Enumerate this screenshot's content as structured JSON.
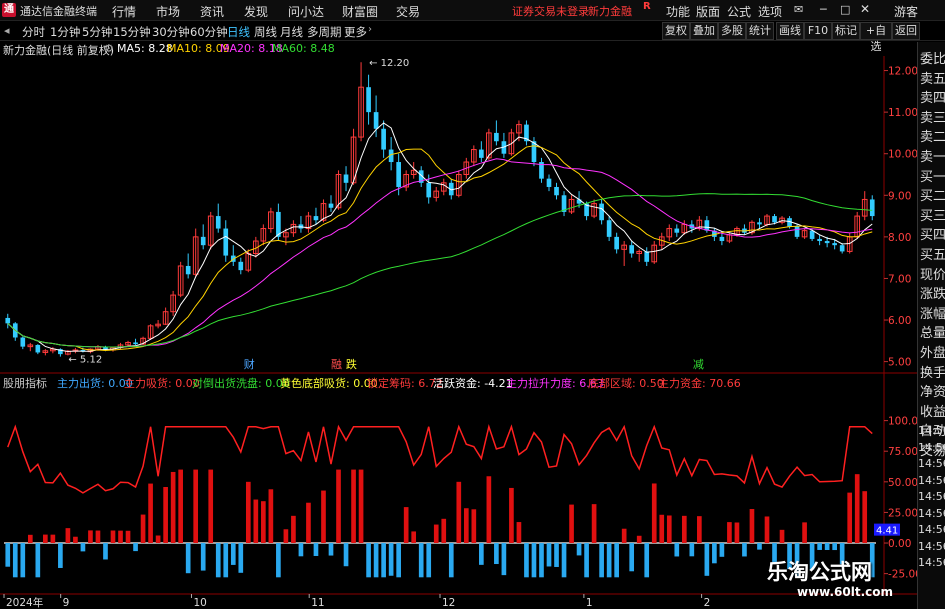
{
  "menubar": {
    "app_title": "通达信金融终端",
    "items": [
      "行情",
      "市场",
      "资讯",
      "发现",
      "问小达",
      "财富圈",
      "交易"
    ],
    "notice": "证券交易未登录",
    "broker": "新力金融",
    "right_items": [
      "功能",
      "版面",
      "公式",
      "选项"
    ],
    "user": "游客"
  },
  "periods": [
    "分时",
    "1分钟",
    "5分钟",
    "15分钟",
    "30分钟",
    "60分钟",
    "日线",
    "周线",
    "月线",
    "多周期",
    "更多"
  ],
  "active_period": "日线",
  "right_buttons": [
    "复权",
    "叠加",
    "多股",
    "统计",
    "画线",
    "F10",
    "标记",
    "+自选",
    "返回"
  ],
  "stock": {
    "label": "新力金融(日线 前复权)"
  },
  "ma": {
    "ma5": {
      "label": "MA5: 8.28",
      "color": "#ffffff"
    },
    "ma10": {
      "label": "MA10: 8.09",
      "color": "#ffd200"
    },
    "ma20": {
      "label": "MA20: 8.18",
      "color": "#ff33ff"
    },
    "ma60": {
      "label": "MA60: 8.48",
      "color": "#33dd33"
    }
  },
  "indicator_line": [
    {
      "text": "股朋指标",
      "color": "#cccccc"
    },
    {
      "text": "主力出货: 0.00",
      "color": "#3fa9ff"
    },
    {
      "text": "主力吸货: 0.00",
      "color": "#ff3b3b"
    },
    {
      "text": "对倒出货洗盘: 0.00",
      "color": "#33dd33"
    },
    {
      "text": "黄色底部吸货: 0.00",
      "color": "#ffff33"
    },
    {
      "text": "锁定筹码: 6.72",
      "color": "#ff3b3b"
    },
    {
      "text": "活跃资金: -4.21",
      "color": "#ffffff"
    },
    {
      "text": "主力拉升力度: 6.63",
      "color": "#ff33ff"
    },
    {
      "text": "底部区域: 0.50",
      "color": "#ff3b3b"
    },
    {
      "text": "主力资金: 70.66",
      "color": "#ff3b3b"
    }
  ],
  "sidebar": [
    "委比",
    "卖五",
    "卖四",
    "卖三",
    "卖二",
    "卖一",
    "买一",
    "买二",
    "买三",
    "买四",
    "买五",
    "现价",
    "涨跌",
    "涨幅",
    "总量",
    "外盘",
    "换手",
    "净资",
    "收益",
    "自动",
    "交易"
  ],
  "time_labels": [
    "14:56",
    "14:56",
    "14:56",
    "14:56",
    "14:56",
    "14:56",
    "14:56",
    "14:56",
    "14:56"
  ],
  "watermark": {
    "title": "乐淘公式网",
    "url": "www.60lt.com"
  },
  "chart_data": {
    "type": "candlestick",
    "x_labels": [
      "2024年",
      "9",
      "10",
      "11",
      "12",
      "1",
      "2"
    ],
    "y_ticks": [
      5.0,
      6.0,
      7.0,
      8.0,
      9.0,
      10.0,
      11.0,
      12.0
    ],
    "y_tick_labels": [
      "5.00",
      "6.00",
      "7.00",
      "8.00",
      "9.00",
      "10.00",
      "11.00",
      "12.00"
    ],
    "ylim": [
      4.75,
      12.35
    ],
    "annotations": {
      "high": "12.20",
      "low": "5.12",
      "events": [
        {
          "text": "财",
          "color": "#4da6ff"
        },
        {
          "text": "融",
          "color": "#ff4d4d"
        },
        {
          "text": "跌",
          "color": "#ffff33"
        },
        {
          "text": "减",
          "color": "#33dd33"
        }
      ]
    },
    "ohlc": [
      [
        6.05,
        6.15,
        5.8,
        5.92
      ],
      [
        5.92,
        5.95,
        5.5,
        5.58
      ],
      [
        5.58,
        5.6,
        5.3,
        5.36
      ],
      [
        5.36,
        5.45,
        5.25,
        5.4
      ],
      [
        5.4,
        5.42,
        5.18,
        5.22
      ],
      [
        5.22,
        5.3,
        5.15,
        5.26
      ],
      [
        5.26,
        5.35,
        5.2,
        5.3
      ],
      [
        5.3,
        5.32,
        5.12,
        5.18
      ],
      [
        5.18,
        5.28,
        5.15,
        5.25
      ],
      [
        5.25,
        5.33,
        5.2,
        5.28
      ],
      [
        5.28,
        5.34,
        5.22,
        5.24
      ],
      [
        5.24,
        5.32,
        5.2,
        5.3
      ],
      [
        5.3,
        5.4,
        5.26,
        5.36
      ],
      [
        5.36,
        5.38,
        5.25,
        5.28
      ],
      [
        5.28,
        5.36,
        5.24,
        5.34
      ],
      [
        5.34,
        5.45,
        5.3,
        5.4
      ],
      [
        5.4,
        5.5,
        5.35,
        5.46
      ],
      [
        5.46,
        5.55,
        5.4,
        5.42
      ],
      [
        5.42,
        5.6,
        5.4,
        5.56
      ],
      [
        5.56,
        5.9,
        5.52,
        5.86
      ],
      [
        5.86,
        6.0,
        5.8,
        5.9
      ],
      [
        5.9,
        6.3,
        5.88,
        6.2
      ],
      [
        6.2,
        6.7,
        6.1,
        6.6
      ],
      [
        6.6,
        7.4,
        6.55,
        7.3
      ],
      [
        7.3,
        7.6,
        7.0,
        7.1
      ],
      [
        7.1,
        8.2,
        7.05,
        8.0
      ],
      [
        8.0,
        8.3,
        7.7,
        7.8
      ],
      [
        7.8,
        8.6,
        7.7,
        8.5
      ],
      [
        8.5,
        8.8,
        8.1,
        8.2
      ],
      [
        8.2,
        8.4,
        7.4,
        7.55
      ],
      [
        7.55,
        7.8,
        7.3,
        7.4
      ],
      [
        7.4,
        7.5,
        7.1,
        7.2
      ],
      [
        7.2,
        7.7,
        7.15,
        7.6
      ],
      [
        7.6,
        8.0,
        7.5,
        7.9
      ],
      [
        7.9,
        8.3,
        7.8,
        8.2
      ],
      [
        8.2,
        8.7,
        8.1,
        8.6
      ],
      [
        8.6,
        8.8,
        7.9,
        8.0
      ],
      [
        8.0,
        8.2,
        7.8,
        8.1
      ],
      [
        8.1,
        8.4,
        8.0,
        8.3
      ],
      [
        8.3,
        8.5,
        8.1,
        8.2
      ],
      [
        8.2,
        8.6,
        8.1,
        8.5
      ],
      [
        8.5,
        8.7,
        8.3,
        8.4
      ],
      [
        8.4,
        8.9,
        8.35,
        8.8
      ],
      [
        8.8,
        9.0,
        8.6,
        8.7
      ],
      [
        8.7,
        9.6,
        8.65,
        9.5
      ],
      [
        9.5,
        9.7,
        9.1,
        9.3
      ],
      [
        9.3,
        10.6,
        9.25,
        10.4
      ],
      [
        10.4,
        12.2,
        10.3,
        11.6
      ],
      [
        11.6,
        11.9,
        10.7,
        11.0
      ],
      [
        11.0,
        11.4,
        10.4,
        10.6
      ],
      [
        10.6,
        10.8,
        9.9,
        10.1
      ],
      [
        10.1,
        10.4,
        9.6,
        9.8
      ],
      [
        9.8,
        10.0,
        9.0,
        9.2
      ],
      [
        9.2,
        9.6,
        9.1,
        9.5
      ],
      [
        9.5,
        9.8,
        9.4,
        9.6
      ],
      [
        9.6,
        9.7,
        9.2,
        9.3
      ],
      [
        9.3,
        9.5,
        8.8,
        8.95
      ],
      [
        8.95,
        9.2,
        8.85,
        9.1
      ],
      [
        9.1,
        9.4,
        9.0,
        9.3
      ],
      [
        9.3,
        9.4,
        8.9,
        9.0
      ],
      [
        9.0,
        9.6,
        8.95,
        9.5
      ],
      [
        9.5,
        9.9,
        9.4,
        9.8
      ],
      [
        9.8,
        10.2,
        9.7,
        10.1
      ],
      [
        10.1,
        10.3,
        9.8,
        9.9
      ],
      [
        9.9,
        10.6,
        9.85,
        10.5
      ],
      [
        10.5,
        10.8,
        10.2,
        10.3
      ],
      [
        10.3,
        10.5,
        9.9,
        10.0
      ],
      [
        10.0,
        10.6,
        9.95,
        10.5
      ],
      [
        10.5,
        10.8,
        10.3,
        10.7
      ],
      [
        10.7,
        10.8,
        10.2,
        10.3
      ],
      [
        10.3,
        10.4,
        9.7,
        9.8
      ],
      [
        9.8,
        9.9,
        9.3,
        9.4
      ],
      [
        9.4,
        9.5,
        9.1,
        9.2
      ],
      [
        9.2,
        9.3,
        8.9,
        9.0
      ],
      [
        9.0,
        9.1,
        8.5,
        8.6
      ],
      [
        8.6,
        9.0,
        8.55,
        8.9
      ],
      [
        8.9,
        9.1,
        8.7,
        8.8
      ],
      [
        8.8,
        8.85,
        8.4,
        8.5
      ],
      [
        8.5,
        8.9,
        8.45,
        8.8
      ],
      [
        8.8,
        8.9,
        8.3,
        8.4
      ],
      [
        8.4,
        8.5,
        7.9,
        8.0
      ],
      [
        8.0,
        8.1,
        7.6,
        7.7
      ],
      [
        7.7,
        7.9,
        7.3,
        7.8
      ],
      [
        7.8,
        7.9,
        7.5,
        7.6
      ],
      [
        7.6,
        7.7,
        7.4,
        7.65
      ],
      [
        7.65,
        7.75,
        7.3,
        7.4
      ],
      [
        7.4,
        7.9,
        7.35,
        7.8
      ],
      [
        7.8,
        8.1,
        7.7,
        8.0
      ],
      [
        8.0,
        8.3,
        7.9,
        8.2
      ],
      [
        8.2,
        8.3,
        8.0,
        8.1
      ],
      [
        8.1,
        8.4,
        8.05,
        8.3
      ],
      [
        8.3,
        8.4,
        8.1,
        8.2
      ],
      [
        8.2,
        8.5,
        8.15,
        8.4
      ],
      [
        8.4,
        8.5,
        8.1,
        8.15
      ],
      [
        8.15,
        8.2,
        7.9,
        8.0
      ],
      [
        8.0,
        8.1,
        7.8,
        7.9
      ],
      [
        7.9,
        8.1,
        7.85,
        8.05
      ],
      [
        8.05,
        8.25,
        8.0,
        8.2
      ],
      [
        8.2,
        8.3,
        8.05,
        8.1
      ],
      [
        8.1,
        8.4,
        8.05,
        8.35
      ],
      [
        8.35,
        8.45,
        8.2,
        8.3
      ],
      [
        8.3,
        8.55,
        8.25,
        8.5
      ],
      [
        8.5,
        8.55,
        8.3,
        8.35
      ],
      [
        8.35,
        8.5,
        8.3,
        8.45
      ],
      [
        8.45,
        8.5,
        8.2,
        8.25
      ],
      [
        8.25,
        8.3,
        7.95,
        8.0
      ],
      [
        8.0,
        8.2,
        7.95,
        8.15
      ],
      [
        8.15,
        8.2,
        7.9,
        7.95
      ],
      [
        7.95,
        8.05,
        7.8,
        7.9
      ],
      [
        7.9,
        8.0,
        7.75,
        7.85
      ],
      [
        7.85,
        7.95,
        7.7,
        7.8
      ],
      [
        7.8,
        7.85,
        7.6,
        7.65
      ],
      [
        7.65,
        8.1,
        7.6,
        8.0
      ],
      [
        8.0,
        8.6,
        7.95,
        8.5
      ],
      [
        8.5,
        9.1,
        8.4,
        8.9
      ],
      [
        8.9,
        9.0,
        8.4,
        8.5
      ]
    ],
    "indicator": {
      "ylim": [
        -40,
        125
      ],
      "y_ticks": [
        -25,
        0,
        25,
        50,
        75,
        100
      ],
      "y_tick_labels": [
        "-25.00",
        "0.00",
        "25.00",
        "50.00",
        "75.00",
        "100.00"
      ],
      "current_label": "4.41"
    }
  }
}
